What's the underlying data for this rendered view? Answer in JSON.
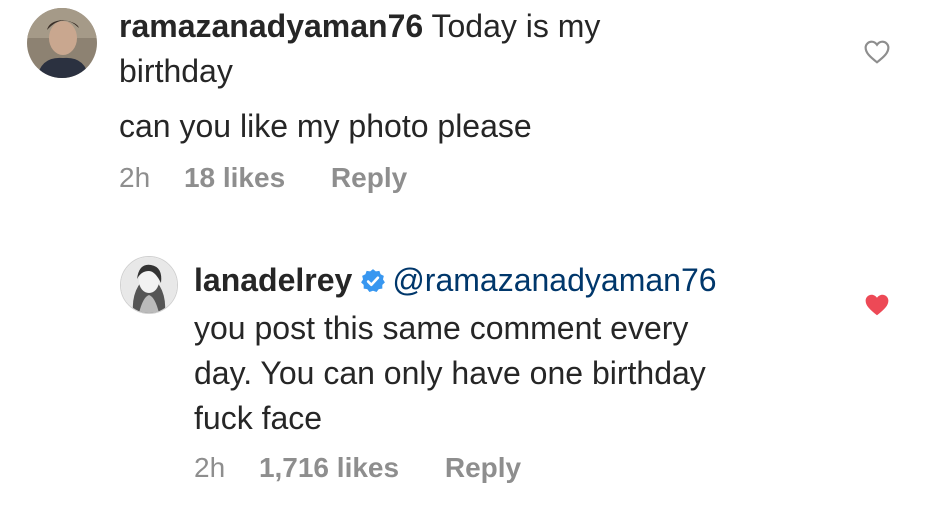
{
  "comments": [
    {
      "username": "ramazanadyaman76",
      "text": "Today is my",
      "text_line2": "birthday",
      "text_line3": "can you like my photo please",
      "time": "2h",
      "likes": "18 likes",
      "reply": "Reply",
      "liked": false
    },
    {
      "username": "lanadelrey",
      "verified": true,
      "mention": "@ramazanadyaman76",
      "text_line1": "you post this same comment every",
      "text_line2": "day. You can only have one birthday",
      "text_line3": "fuck face",
      "time": "2h",
      "likes": "1,716 likes",
      "reply": "Reply",
      "liked": true
    }
  ],
  "colors": {
    "text": "#262626",
    "meta": "#8e8e8e",
    "mention": "#00376b",
    "verified": "#3897f0",
    "heart_liked": "#ed4956",
    "heart_outline": "#8e8e8e"
  },
  "icons": {
    "verified": "verified-badge-icon",
    "heart_outline": "heart-outline-icon",
    "heart_filled": "heart-filled-icon"
  }
}
